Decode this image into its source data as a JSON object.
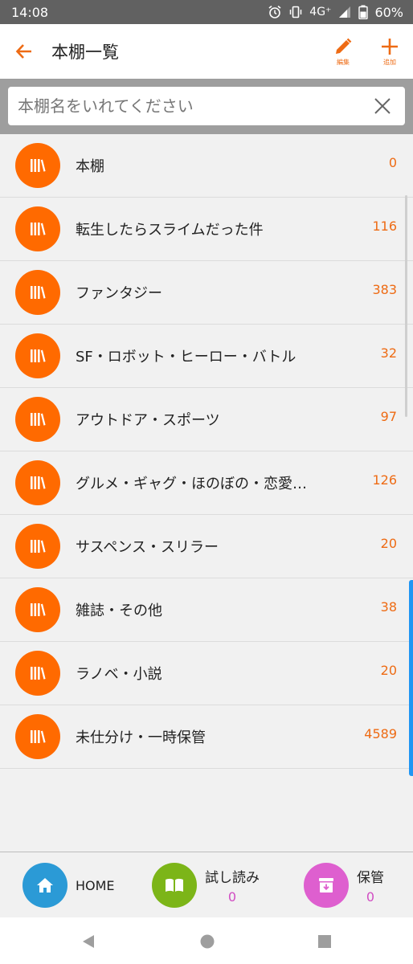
{
  "status_bar": {
    "time": "14:08",
    "network": "4G⁺",
    "battery": "60%",
    "icons": [
      "alarm-icon",
      "vibrate-icon",
      "signal-icon",
      "battery-icon"
    ]
  },
  "app_bar": {
    "title": "本棚一覧",
    "edit_label": "編集",
    "add_label": "追加",
    "accent": "#ee6b14"
  },
  "search": {
    "placeholder": "本棚名をいれてください",
    "value": ""
  },
  "shelves": [
    {
      "name": "本棚",
      "count": "0"
    },
    {
      "name": "転生したらスライムだった件",
      "count": "116"
    },
    {
      "name": "ファンタジー",
      "count": "383"
    },
    {
      "name": "SF・ロボット・ヒーロー・バトル",
      "count": "32"
    },
    {
      "name": "アウトドア・スポーツ",
      "count": "97"
    },
    {
      "name": "グルメ・ギャグ・ほのぼの・恋愛…",
      "count": "126"
    },
    {
      "name": "サスペンス・スリラー",
      "count": "20"
    },
    {
      "name": "雑誌・その他",
      "count": "38"
    },
    {
      "name": "ラノベ・小説",
      "count": "20"
    },
    {
      "name": "未仕分け・一時保管",
      "count": "4589"
    }
  ],
  "bottom_nav": {
    "home": {
      "label": "HOME",
      "color": "#2b9ad6"
    },
    "trial": {
      "label": "試し読み",
      "count": "0",
      "color": "#7cb518"
    },
    "archive": {
      "label": "保管",
      "count": "0",
      "color": "#de5fcf"
    }
  },
  "colors": {
    "shelf_icon": "#ff6a00",
    "count_text": "#ee6b14",
    "nav_count": "#d14ec3"
  }
}
